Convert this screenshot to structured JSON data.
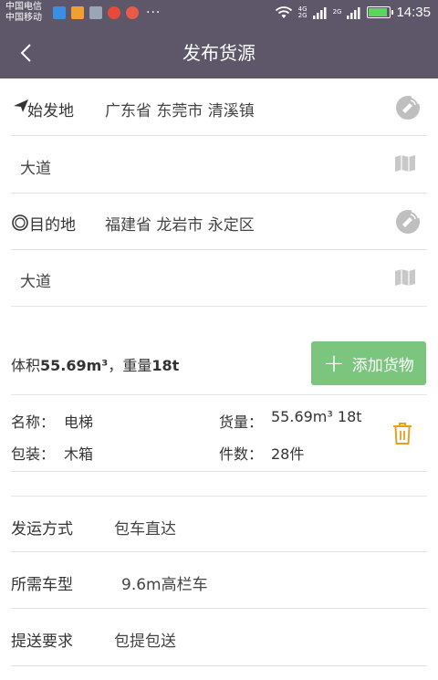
{
  "status": {
    "carrier1": "中国电信",
    "carrier2": "中国移动",
    "net_top": "4G",
    "net_bottom": "2G",
    "net2": "2G",
    "dots": "···",
    "time": "14:35"
  },
  "nav": {
    "title": "发布货源"
  },
  "origin": {
    "label": "始发地",
    "region": "广东省 东莞市 清溪镇",
    "address": "大道"
  },
  "destination": {
    "label": "目的地",
    "region": "福建省 龙岩市 永定区",
    "address": "大道"
  },
  "summary": {
    "volume_label": "体积",
    "volume": "55.69m³",
    "sep": "，",
    "weight_label": "重量",
    "weight": "18t"
  },
  "add_button": {
    "label": "添加货物"
  },
  "cargo": {
    "name_label": "名称：",
    "name": "电梯",
    "qty_label": "货量：",
    "qty": "55.69m³ 18t",
    "pack_label": "包装：",
    "pack": "木箱",
    "count_label": "件数：",
    "count": "28件"
  },
  "options": [
    {
      "label": "发运方式",
      "value": "包车直达"
    },
    {
      "label": "所需车型",
      "value": "9.6m高栏车"
    },
    {
      "label": "提送要求",
      "value": "包提包送"
    }
  ],
  "colors": {
    "nav_bg": "#5d5769",
    "accent_green": "#7bc57e",
    "trash_orange": "#e8a020"
  }
}
